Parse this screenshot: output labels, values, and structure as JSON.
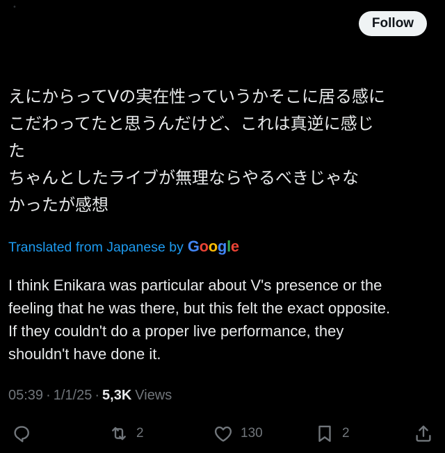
{
  "header": {
    "follow_label": "Follow"
  },
  "tweet": {
    "original_lines": [
      "えにからってVの実在性っていうかそこに居る感に",
      "こだわってたと思うんだけど、これは真逆に感じ",
      "た",
      "ちゃんとしたライブが無理ならやるべきじゃな",
      "かったが感想"
    ],
    "translated_from": "Translated from Japanese by",
    "translator_logo_letters": [
      "G",
      "o",
      "o",
      "g",
      "l",
      "e"
    ],
    "translation_lines": [
      "I think Enikara was particular about V's presence or the",
      "feeling that he was there, but this felt the exact opposite.",
      "If they couldn't do a proper live performance, they",
      "shouldn't have done it."
    ]
  },
  "meta": {
    "time": "05:39",
    "separator": "·",
    "date": "1/1/25",
    "views_count": "5,3K",
    "views_label": "Views"
  },
  "actions": {
    "reply": {
      "icon": "reply-icon",
      "count": ""
    },
    "repost": {
      "icon": "repost-icon",
      "count": "2"
    },
    "like": {
      "icon": "heart-icon",
      "count": "130"
    },
    "bookmark": {
      "icon": "bookmark-icon",
      "count": "2"
    },
    "share": {
      "icon": "share-icon",
      "count": ""
    }
  },
  "colors": {
    "background": "#000000",
    "text": "#e7e9ea",
    "muted": "#71767b",
    "link": "#1d9bf0",
    "follow_bg": "#eff3f4"
  }
}
